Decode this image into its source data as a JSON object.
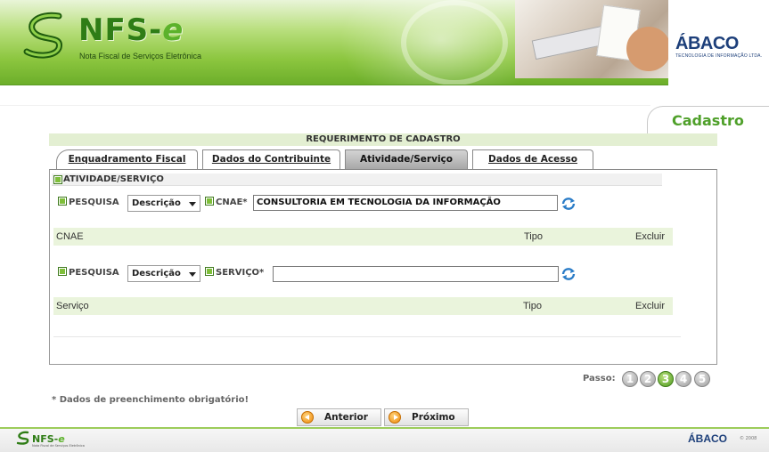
{
  "header": {
    "logo_text": "NFS-",
    "logo_e": "e",
    "logo_subtitle": "Nota Fiscal de Serviços Eletrônica",
    "partner_logo": "ÁBACO",
    "partner_subtitle": "TECNOLOGIA DE INFORMAÇÃO LTDA."
  },
  "page": {
    "section_label": "Cadastro",
    "title": "REQUERIMENTO DE CADASTRO"
  },
  "tabs": [
    {
      "label": "Enquadramento Fiscal",
      "active": false
    },
    {
      "label": "Dados do Contribuinte",
      "active": false
    },
    {
      "label": "Atividade/Serviço",
      "active": true
    },
    {
      "label": "Dados de Acesso",
      "active": false
    }
  ],
  "activity_section": {
    "title": "ATIVIDADE/SERVIÇO"
  },
  "cnae_search": {
    "search_label": "PESQUISA",
    "search_type": "Descrição",
    "field_label": "CNAE*",
    "field_value": "CONSULTORIA EM TECNOLOGIA DA INFORMAÇÃO",
    "refresh_icon": "refresh-icon"
  },
  "cnae_table": {
    "columns": [
      "CNAE",
      "Tipo",
      "Excluir"
    ]
  },
  "service_search": {
    "search_label": "PESQUISA",
    "search_type": "Descrição",
    "field_label": "SERVIÇO*",
    "field_value": "",
    "refresh_icon": "refresh-icon"
  },
  "service_table": {
    "columns": [
      "Serviço",
      "Tipo",
      "Excluir"
    ]
  },
  "steps": {
    "label": "Passo:",
    "items": [
      "1",
      "2",
      "3",
      "4",
      "5"
    ],
    "current": 3
  },
  "required_note": "* Dados de preenchimento obrigatório!",
  "nav": {
    "prev_label": "Anterior",
    "next_label": "Próximo"
  },
  "footer": {
    "logo_text": "NFS-",
    "logo_e": "e",
    "logo_subtitle": "Nota Fiscal de Serviços Eletrônica",
    "partner_logo": "ÁBACO",
    "year": "© 2008"
  },
  "colors": {
    "brand_green": "#4fa02a",
    "light_green": "#eaf4dc",
    "partner_blue": "#1d3f7a"
  }
}
